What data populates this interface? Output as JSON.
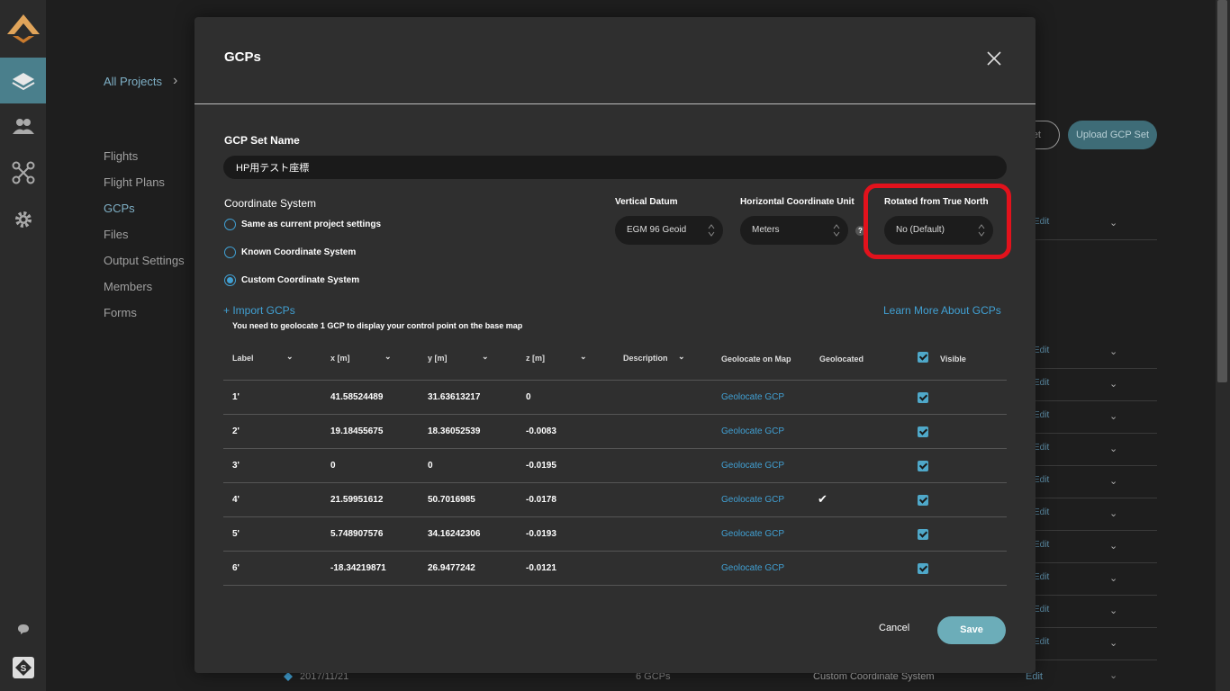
{
  "breadcrumb": {
    "all_projects": "All Projects",
    "sep": "›"
  },
  "side_nav": [
    "Flights",
    "Flight Plans",
    "GCPs",
    "Files",
    "Output Settings",
    "Members",
    "Forms"
  ],
  "bg_buttons": {
    "outline": "et",
    "upload": "Upload GCP Set"
  },
  "bg_rows": {
    "edit_label": "Edit",
    "last_date": "2017/11/21",
    "last_count": "6 GCPs",
    "last_system": "Custom Coordinate System",
    "last_edit": "Edit"
  },
  "modal": {
    "title": "GCPs",
    "set_name_label": "GCP Set Name",
    "set_name_value": "HP用テスト座標",
    "coord_label": "Coordinate System",
    "radios": [
      {
        "label": "Same as current project settings",
        "checked": false
      },
      {
        "label": "Known Coordinate System",
        "checked": false
      },
      {
        "label": "Custom Coordinate System",
        "checked": true
      }
    ],
    "vertical_datum": {
      "label": "Vertical Datum",
      "value": "EGM 96 Geoid"
    },
    "horizontal_unit": {
      "label": "Horizontal Coordinate Unit",
      "value": "Meters",
      "help": "?"
    },
    "rotated": {
      "label": "Rotated from True North",
      "value": "No (Default)"
    },
    "import_link": "+ Import GCPs",
    "note": "You need to geolocate 1 GCP to display your control point on the base map",
    "learn_link": "Learn More About GCPs",
    "headers": {
      "label": "Label",
      "x": "x [m]",
      "y": "y [m]",
      "z": "z [m]",
      "description": "Description",
      "geolocate": "Geolocate on Map",
      "geolocated": "Geolocated",
      "visible": "Visible"
    },
    "rows": [
      {
        "label": "1'",
        "x": "41.58524489",
        "y": "31.63613217",
        "z": "0",
        "action": "Geolocate GCP",
        "geolocated": false,
        "visible": true
      },
      {
        "label": "2'",
        "x": "19.18455675",
        "y": "18.36052539",
        "z": "-0.0083",
        "action": "Geolocate GCP",
        "geolocated": false,
        "visible": true
      },
      {
        "label": "3'",
        "x": "0",
        "y": "0",
        "z": "-0.0195",
        "action": "Geolocate GCP",
        "geolocated": false,
        "visible": true
      },
      {
        "label": "4'",
        "x": "21.59951612",
        "y": "50.7016985",
        "z": "-0.0178",
        "action": "Geolocate GCP",
        "geolocated": true,
        "visible": true
      },
      {
        "label": "5'",
        "x": "5.748907576",
        "y": "34.16242306",
        "z": "-0.0193",
        "action": "Geolocate GCP",
        "geolocated": false,
        "visible": true
      },
      {
        "label": "6'",
        "x": "-18.34219871",
        "y": "26.9477242",
        "z": "-0.0121",
        "action": "Geolocate GCP",
        "geolocated": false,
        "visible": true
      }
    ],
    "cancel": "Cancel",
    "save": "Save"
  },
  "icons": [
    "logo-icon",
    "layers-icon",
    "users-icon",
    "drone-icon",
    "settings-icon",
    "chat-icon",
    "app-badge-icon",
    "close-icon",
    "chevron-down-icon",
    "sort-chevron-icon",
    "checkmark-icon"
  ],
  "colors": {
    "accent": "#41a0d3",
    "active_rail": "#4a7f8c",
    "highlight": "#e2121c",
    "save": "#6cadb9"
  }
}
